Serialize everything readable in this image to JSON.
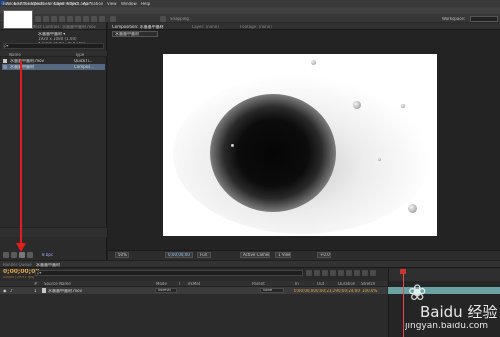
{
  "app": {
    "title": "Adobe After Effects - Untitled Project.aep *",
    "menu": [
      "File",
      "Edit",
      "Composition",
      "Layer",
      "Effect",
      "Animation",
      "View",
      "Window",
      "Help"
    ],
    "snapping_label": "Snapping",
    "workspace_label": "Workspace:"
  },
  "project_panel": {
    "tabs": [
      "Project",
      "Effect Controls: 水墨墨中墨材.mov"
    ],
    "selected_item": "水墨墨中墨材 ▾",
    "meta": [
      "1920 x 1080 (1.00)",
      "Δ 0;00;24;00, 29.97 fps"
    ],
    "columns": [
      "Name",
      "Type"
    ],
    "items": [
      {
        "name": "水墨墨中墨材.mov",
        "type": "QuickTi...",
        "icon_color": "#c9c9c9"
      },
      {
        "name": "水墨墨中墨材",
        "type": "Compos...",
        "icon_color": "#7b8fb1"
      }
    ],
    "bpc": "8 bpc"
  },
  "composition": {
    "tabs": [
      "Composition: 水墨墨中墨材",
      "Layer: (none)",
      "Footage: (none)"
    ],
    "breadcrumb": "水墨墨中墨材",
    "zoom": "50%",
    "timecode": "0;00;00;00",
    "resolution": "Full",
    "camera": "Active Camera",
    "view": "1 View",
    "exposure": "+0.0"
  },
  "timeline": {
    "tabs": [
      "Render Queue",
      "水墨墨中墨材"
    ],
    "timecode": "0;00;00;00",
    "fps_label": "00000 (29.97 fps)",
    "search_placeholder": "ρ▾",
    "columns": [
      "#",
      "Source Name",
      "Mode",
      "T",
      "TrkMat",
      "Parent",
      "In",
      "Out",
      "Duration",
      "Stretch"
    ],
    "layer": {
      "index": "1",
      "name": "水墨墨中墨材.mov",
      "mode": "Normal",
      "parent": "None",
      "in": "0;00;00;00",
      "out": "0;00;23;29",
      "duration": "0;00;24;00",
      "stretch": "100.0%"
    }
  },
  "watermark": {
    "brand": "Baidu 经验",
    "url": "jingyan.baidu.com"
  }
}
